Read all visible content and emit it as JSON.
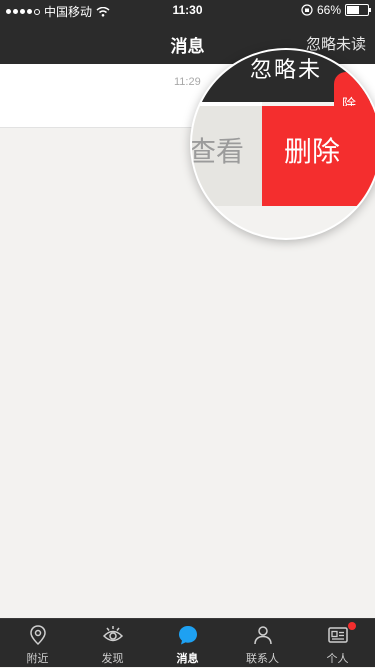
{
  "status": {
    "carrier": "中国移动",
    "time": "11:30",
    "battery_text": "66%",
    "battery_level": 0.66
  },
  "nav": {
    "title": "消息",
    "right_action": "忽略未读"
  },
  "message": {
    "time": "11:29"
  },
  "magnifier": {
    "top_text": "忽略未",
    "top_red_text": "除",
    "view_label": "查看",
    "delete_label": "删除"
  },
  "tabs": [
    {
      "label": "附近",
      "icon": "location-pin-icon"
    },
    {
      "label": "发现",
      "icon": "eye-icon"
    },
    {
      "label": "消息",
      "icon": "chat-bubble-icon",
      "active": true
    },
    {
      "label": "联系人",
      "icon": "person-icon"
    },
    {
      "label": "个人",
      "icon": "id-card-icon",
      "badge": true
    }
  ],
  "colors": {
    "bar": "#2b2b2b",
    "accent_blue": "#1ea1f2",
    "delete_red": "#f42e2e",
    "background": "#f3f2f0"
  }
}
